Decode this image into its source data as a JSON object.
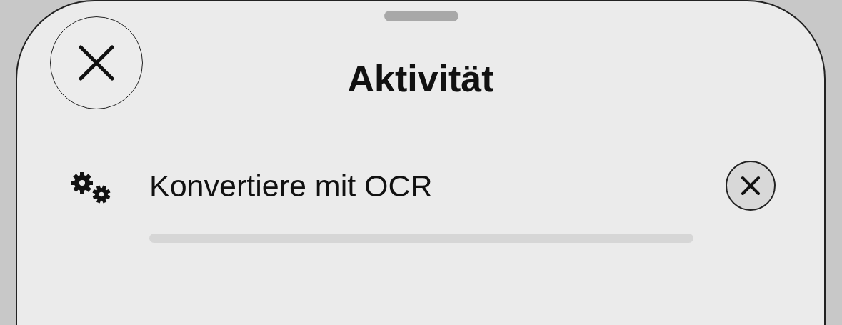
{
  "title": "Aktivität",
  "tasks": [
    {
      "label": "Konvertiere mit OCR",
      "level": 0
    }
  ]
}
